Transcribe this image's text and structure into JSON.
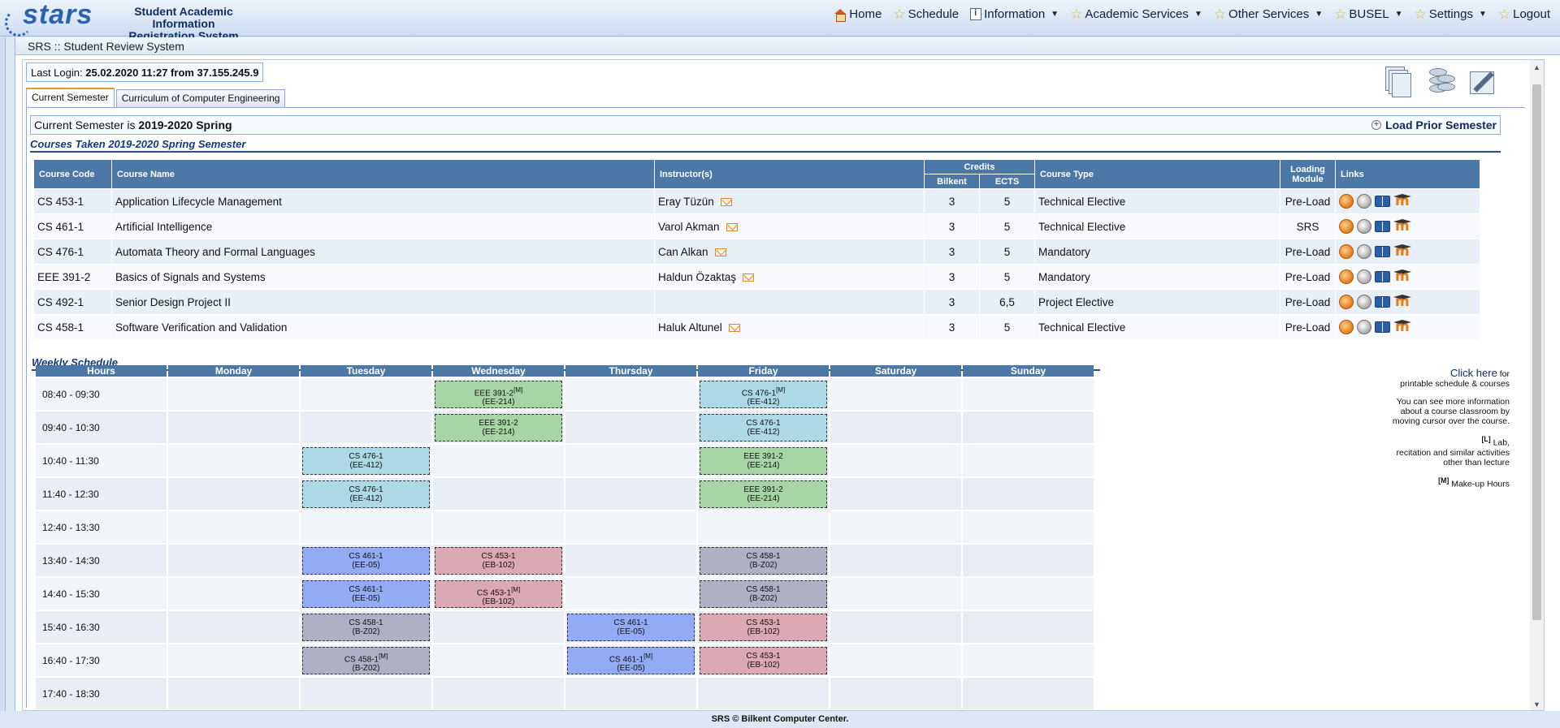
{
  "app": {
    "logo_text": "stars",
    "title_line1": "Student Academic Information",
    "title_line2": "Registration System"
  },
  "nav": [
    {
      "label": "Home",
      "icon": "home-icon",
      "dropdown": false
    },
    {
      "label": "Schedule",
      "icon": "star-icon",
      "dropdown": false
    },
    {
      "label": "Information",
      "icon": "info-icon",
      "dropdown": true
    },
    {
      "label": "Academic Services",
      "icon": "star-icon",
      "dropdown": true
    },
    {
      "label": "Other Services",
      "icon": "star-icon",
      "dropdown": true
    },
    {
      "label": "BUSEL",
      "icon": "star-icon",
      "dropdown": true
    },
    {
      "label": "Settings",
      "icon": "star-icon",
      "dropdown": true
    },
    {
      "label": "Logout",
      "icon": "star-icon",
      "dropdown": false
    }
  ],
  "breadcrumb": "SRS :: Student Review System",
  "last_login": {
    "label": "Last Login:",
    "value": "25.02.2020 11:27 from 37.155.245.9"
  },
  "tabs": [
    "Current Semester",
    "Curriculum of Computer Engineering"
  ],
  "semester": {
    "prefix": "Current Semester is",
    "value": "2019-2020 Spring",
    "load_prior": "Load Prior Semester"
  },
  "courses_title": "Courses Taken 2019-2020 Spring Semester",
  "course_headers": {
    "code": "Course Code",
    "name": "Course Name",
    "instructor": "Instructor(s)",
    "credits": "Credits",
    "bilkent": "Bilkent",
    "ects": "ECTS",
    "type": "Course Type",
    "loading": "Loading Module",
    "links": "Links"
  },
  "courses": [
    {
      "code": "CS 453-1",
      "name": "Application Lifecycle Management",
      "instructor": "Eray Tüzün",
      "bilkent": "3",
      "ects": "5",
      "type": "Technical Elective",
      "loading": "Pre-Load"
    },
    {
      "code": "CS 461-1",
      "name": "Artificial Intelligence",
      "instructor": "Varol Akman",
      "bilkent": "3",
      "ects": "5",
      "type": "Technical Elective",
      "loading": "SRS"
    },
    {
      "code": "CS 476-1",
      "name": "Automata Theory and Formal Languages",
      "instructor": "Can Alkan",
      "bilkent": "3",
      "ects": "5",
      "type": "Mandatory",
      "loading": "Pre-Load"
    },
    {
      "code": "EEE 391-2",
      "name": "Basics of Signals and Systems",
      "instructor": "Haldun Özaktaş",
      "bilkent": "3",
      "ects": "5",
      "type": "Mandatory",
      "loading": "Pre-Load"
    },
    {
      "code": "CS 492-1",
      "name": "Senior Design Project II",
      "instructor": "",
      "bilkent": "3",
      "ects": "6,5",
      "type": "Project Elective",
      "loading": "Pre-Load"
    },
    {
      "code": "CS 458-1",
      "name": "Software Verification and Validation",
      "instructor": "Haluk Altunel",
      "bilkent": "3",
      "ects": "5",
      "type": "Technical Elective",
      "loading": "Pre-Load"
    }
  ],
  "schedule_title": "Weekly Schedule",
  "schedule_headers": [
    "Hours",
    "Monday",
    "Tuesday",
    "Wednesday",
    "Thursday",
    "Friday",
    "Saturday",
    "Sunday"
  ],
  "schedule": [
    {
      "hour": "08:40 - 09:30",
      "cells": [
        null,
        null,
        {
          "course": "EEE 391-2",
          "mark": "[M]",
          "room": "(EE-214)",
          "color": "green"
        },
        null,
        {
          "course": "CS 476-1",
          "mark": "[M]",
          "room": "(EE-412)",
          "color": "blue"
        },
        null,
        null
      ]
    },
    {
      "hour": "09:40 - 10:30",
      "cells": [
        null,
        null,
        {
          "course": "EEE 391-2",
          "mark": "",
          "room": "(EE-214)",
          "color": "green"
        },
        null,
        {
          "course": "CS 476-1",
          "mark": "",
          "room": "(EE-412)",
          "color": "blue"
        },
        null,
        null
      ]
    },
    {
      "hour": "10:40 - 11:30",
      "cells": [
        null,
        {
          "course": "CS 476-1",
          "mark": "",
          "room": "(EE-412)",
          "color": "blue"
        },
        null,
        null,
        {
          "course": "EEE 391-2",
          "mark": "",
          "room": "(EE-214)",
          "color": "green"
        },
        null,
        null
      ]
    },
    {
      "hour": "11:40 - 12:30",
      "cells": [
        null,
        {
          "course": "CS 476-1",
          "mark": "",
          "room": "(EE-412)",
          "color": "blue"
        },
        null,
        null,
        {
          "course": "EEE 391-2",
          "mark": "",
          "room": "(EE-214)",
          "color": "green"
        },
        null,
        null
      ]
    },
    {
      "hour": "12:40 - 13:30",
      "cells": [
        null,
        null,
        null,
        null,
        null,
        null,
        null
      ]
    },
    {
      "hour": "13:40 - 14:30",
      "cells": [
        null,
        {
          "course": "CS 461-1",
          "mark": "",
          "room": "(EE-05)",
          "color": "periwinkle"
        },
        {
          "course": "CS 453-1",
          "mark": "",
          "room": "(EB-102)",
          "color": "pink"
        },
        null,
        {
          "course": "CS 458-1",
          "mark": "",
          "room": "(B-Z02)",
          "color": "slate"
        },
        null,
        null
      ]
    },
    {
      "hour": "14:40 - 15:30",
      "cells": [
        null,
        {
          "course": "CS 461-1",
          "mark": "",
          "room": "(EE-05)",
          "color": "periwinkle"
        },
        {
          "course": "CS 453-1",
          "mark": "[M]",
          "room": "(EB-102)",
          "color": "pink"
        },
        null,
        {
          "course": "CS 458-1",
          "mark": "",
          "room": "(B-Z02)",
          "color": "slate"
        },
        null,
        null
      ]
    },
    {
      "hour": "15:40 - 16:30",
      "cells": [
        null,
        {
          "course": "CS 458-1",
          "mark": "",
          "room": "(B-Z02)",
          "color": "slate"
        },
        null,
        {
          "course": "CS 461-1",
          "mark": "",
          "room": "(EE-05)",
          "color": "periwinkle"
        },
        {
          "course": "CS 453-1",
          "mark": "",
          "room": "(EB-102)",
          "color": "pink"
        },
        null,
        null
      ]
    },
    {
      "hour": "16:40 - 17:30",
      "cells": [
        null,
        {
          "course": "CS 458-1",
          "mark": "[M]",
          "room": "(B-Z02)",
          "color": "slate"
        },
        null,
        {
          "course": "CS 461-1",
          "mark": "[M]",
          "room": "(EE-05)",
          "color": "periwinkle"
        },
        {
          "course": "CS 453-1",
          "mark": "",
          "room": "(EB-102)",
          "color": "pink"
        },
        null,
        null
      ]
    },
    {
      "hour": "17:40 - 18:30",
      "cells": [
        null,
        null,
        null,
        null,
        null,
        null,
        null
      ]
    }
  ],
  "notes": {
    "click_here": "Click here",
    "click_suffix": "for",
    "printable": "printable schedule & courses",
    "more_info_1": "You can see more information",
    "more_info_2": "about a course classroom by",
    "more_info_3": "moving cursor over the course.",
    "lab_mark": "[L]",
    "lab_1": "Lab,",
    "lab_2": "recitation and similar activities",
    "lab_3": "other than lecture",
    "makeup_mark": "[M]",
    "makeup": "Make-up Hours"
  },
  "footer": "SRS © Bilkent Computer Center.",
  "colors": {
    "header_blue": "#4c78a8",
    "green": "#a6d4a4",
    "blue": "#add8e6",
    "periwinkle": "#93aaf5",
    "pink": "#dba8b3",
    "slate": "#aeb1c6"
  }
}
